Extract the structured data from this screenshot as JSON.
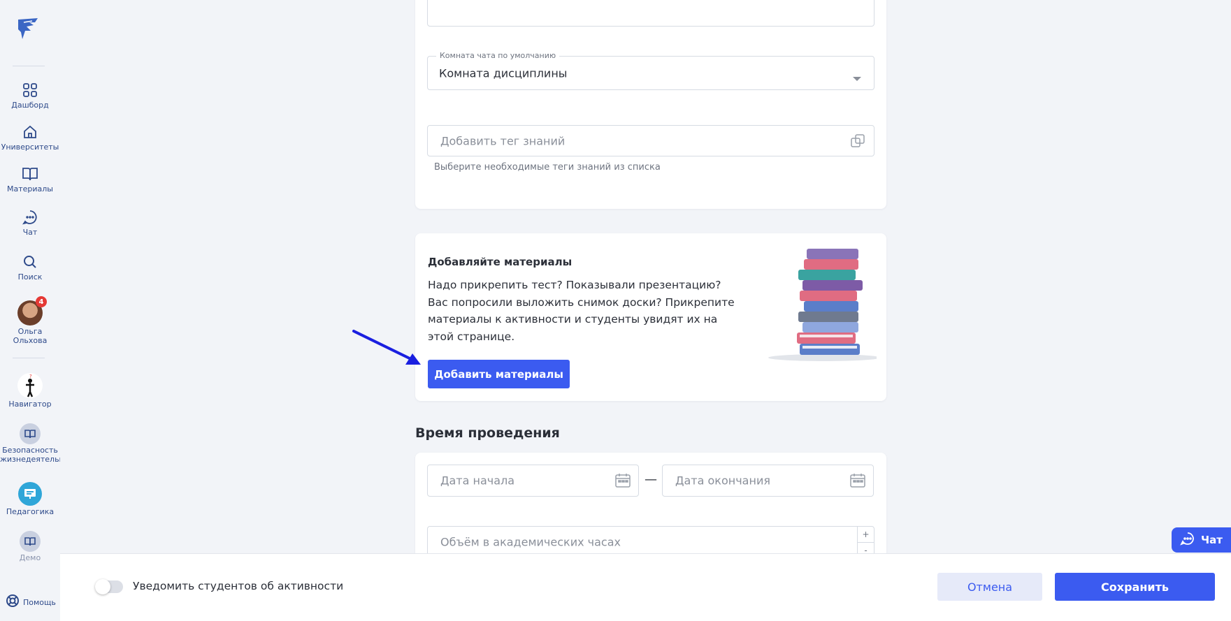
{
  "sidebar": {
    "items": [
      {
        "label": "Дашборд"
      },
      {
        "label": "Университеты"
      },
      {
        "label": "Материалы"
      },
      {
        "label": "Чат"
      },
      {
        "label": "Поиск"
      }
    ],
    "user": {
      "name_line1": "Ольга",
      "name_line2": "Ольхова",
      "badge": "4"
    },
    "courses": [
      {
        "label": "Навигатор"
      },
      {
        "label": "Безопасность жизнедеятельн"
      },
      {
        "label": "Педагогика"
      },
      {
        "label": "Демо"
      }
    ],
    "help_label": "Помощь"
  },
  "form": {
    "chat_room": {
      "legend": "Комната чата по умолчанию",
      "value": "Комната дисциплины"
    },
    "knowledge_tag": {
      "placeholder": "Добавить тег знаний",
      "hint": "Выберите необходимые теги знаний из списка"
    }
  },
  "materials": {
    "title": "Добавляйте материалы",
    "text": "Надо прикрепить тест? Показывали презентацию? Вас попросили выложить снимок доски? Прикрепите материалы к активности и студенты увидят их на этой странице.",
    "button": "Добавить материалы"
  },
  "schedule": {
    "title": "Время проведения",
    "start_placeholder": "Дата начала",
    "end_placeholder": "Дата окончания",
    "dash": "—",
    "hours_placeholder": "Объём в академических часах",
    "plus": "+",
    "minus": "-"
  },
  "bottom": {
    "notify_label": "Уведомить студентов об активности",
    "cancel": "Отмена",
    "save": "Сохранить"
  },
  "chat_widget": {
    "label": "Чат"
  },
  "colors": {
    "accent": "#3b5bf0",
    "nav_text": "#2e4a8a",
    "badge": "#e53935"
  }
}
